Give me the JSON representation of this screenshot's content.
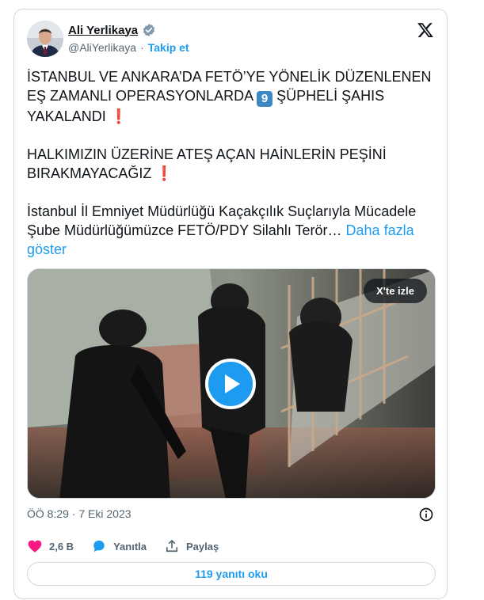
{
  "author": {
    "name": "Ali Yerlikaya",
    "handle": "@AliYerlikaya",
    "separator": "·",
    "follow_label": "Takip et"
  },
  "tweet": {
    "p1_a": "İSTANBUL VE ANKARA’DA FETÖ’YE YÖNELİK DÜZENLENEN EŞ ZAMANLI OPERASYONLARDA ",
    "p1_num": "9",
    "p1_b": " ŞÜPHELİ ŞAHIS YAKALANDI",
    "p2": "HALKIMIZIN ÜZERİNE ATEŞ AÇAN HAİNLERİN PEŞİNİ BIRAKMAYACAĞIZ",
    "exclamation": "❗",
    "p3": "İstanbul İl Emniyet Müdürlüğü Kaçakçılık Suçlarıyla Mücadele Şube Müdürlüğümüzce FETÖ/PDY Silahlı Terör…",
    "more_label": "Daha fazla göster"
  },
  "media": {
    "watch_label": "X'te izle"
  },
  "timestamp": "ÖÖ 8:29 · 7 Eki 2023",
  "actions": {
    "likes": "2,6 B",
    "reply_label": "Yanıtla",
    "share_label": "Paylaş"
  },
  "replies_button_label": "119 yanıtı oku",
  "colors": {
    "accent": "#1d9bf0",
    "like_pink": "#f91880",
    "secondary_text": "#536471",
    "border": "#cfd9de"
  },
  "icons": [
    "verified-badge-icon",
    "x-logo-icon",
    "play-icon",
    "info-icon",
    "heart-icon",
    "reply-bubble-icon",
    "share-icon"
  ]
}
